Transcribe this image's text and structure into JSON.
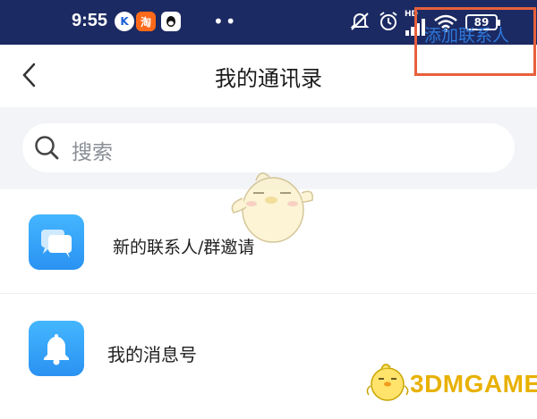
{
  "status_bar": {
    "time": "9:55",
    "app_icons": [
      "k-app-icon",
      "taobao-icon",
      "qq-icon"
    ],
    "dots": "••",
    "battery": "89",
    "hd_label": "HD"
  },
  "header": {
    "title": "我的通讯录",
    "add_contact": "添加联系人"
  },
  "search": {
    "placeholder": "搜索"
  },
  "list": [
    {
      "label": "新的联系人/群邀请",
      "icon": "chat-bubble-icon"
    },
    {
      "label": "我的消息号",
      "icon": "bell-icon"
    }
  ],
  "watermark": {
    "text": "3DMGAME"
  },
  "colors": {
    "status_bar_bg": "#1c2a63",
    "link_blue": "#2f78d9",
    "highlight_box": "#e8603c",
    "icon_blue": "#2a92f2"
  }
}
